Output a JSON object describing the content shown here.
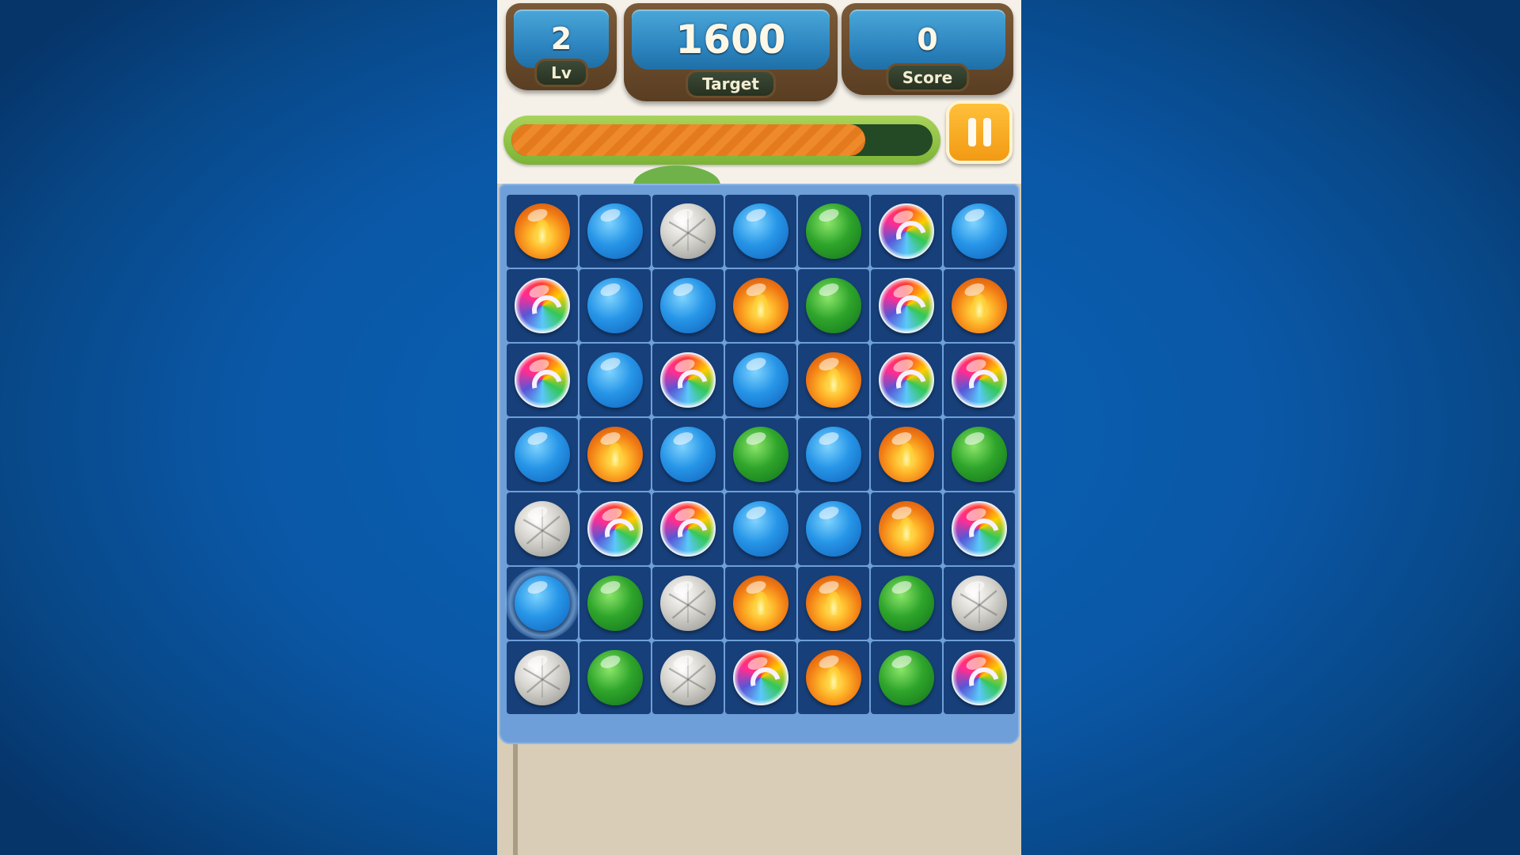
{
  "hud": {
    "level": {
      "value": "2",
      "label": "Lv"
    },
    "target": {
      "value": "1600",
      "label": "Target"
    },
    "score": {
      "value": "0",
      "label": "Score"
    }
  },
  "progress": {
    "fraction": 0.84
  },
  "pause_icon": "pause-icon",
  "colors": {
    "background": "#0a57a6",
    "board": "#6f9fd8",
    "cell": "#17407a",
    "progress_fill": "#ef8a2a",
    "pause_button": "#f29a14"
  },
  "board": {
    "selected": {
      "row": 5,
      "col": 0
    },
    "rows": [
      [
        "fire",
        "blue",
        "stone",
        "blue",
        "green",
        "rainbow",
        "blue"
      ],
      [
        "rainbow",
        "blue",
        "blue",
        "fire",
        "green",
        "rainbow",
        "fire"
      ],
      [
        "rainbow",
        "blue",
        "rainbow",
        "blue",
        "fire",
        "rainbow",
        "rainbow"
      ],
      [
        "blue",
        "fire",
        "blue",
        "green",
        "blue",
        "fire",
        "green"
      ],
      [
        "stone",
        "rainbow",
        "rainbow",
        "blue",
        "blue",
        "fire",
        "rainbow"
      ],
      [
        "blue",
        "green",
        "stone",
        "fire",
        "fire",
        "green",
        "stone"
      ],
      [
        "stone",
        "green",
        "stone",
        "rainbow",
        "fire",
        "green",
        "rainbow"
      ]
    ]
  }
}
